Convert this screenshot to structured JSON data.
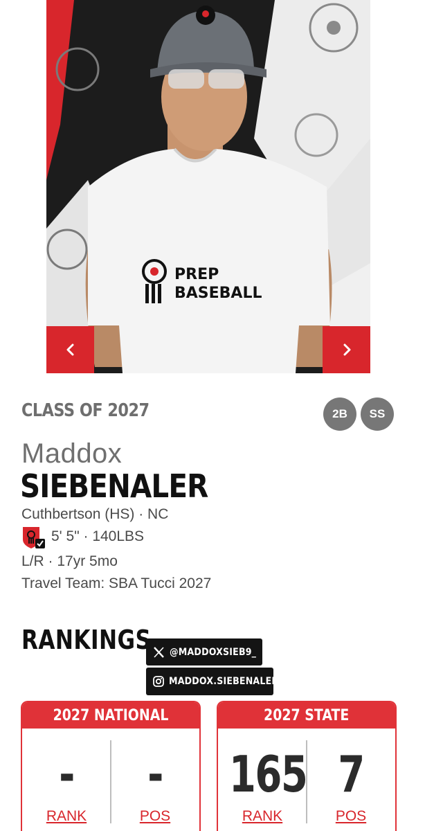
{
  "carousel": {
    "prev_icon": "chevron-left-icon",
    "next_icon": "chevron-right-icon",
    "shirt_logo_text_1": "PREP",
    "shirt_logo_text_2": "BASEBALL",
    "colors": {
      "nav_button": "#d8262c",
      "backdrop_dark": "#1b1b1b",
      "backdrop_light": "#e9e9e9"
    }
  },
  "profile": {
    "class_of": "CLASS OF 2027",
    "positions": [
      "2B",
      "SS"
    ],
    "first_name": "Maddox",
    "last_name": "SIEBENALER",
    "school": "Cuthbertson (HS) · NC",
    "metrics": "5' 5\" · 140LBS",
    "bat_throw_age": "L/R · 17yr 5mo",
    "travel_team": "Travel Team: SBA Tucci 2027",
    "verified_icon": "verified-shield-icon"
  },
  "rankings": {
    "title": "RANKINGS",
    "social": {
      "x_handle": "@MADDOXSIEB9_",
      "instagram_handle": "MADDOX.SIEBENALER"
    },
    "national": {
      "header": "2027 NATIONAL",
      "rank_value": "-",
      "rank_label": "RANK",
      "pos_value": "-",
      "pos_label": "POS"
    },
    "state": {
      "header": "2027 STATE",
      "rank_value": "165",
      "rank_label": "RANK",
      "pos_value": "7",
      "pos_label": "POS"
    },
    "colors": {
      "accent": "#e03238",
      "link": "#d8262c"
    }
  }
}
